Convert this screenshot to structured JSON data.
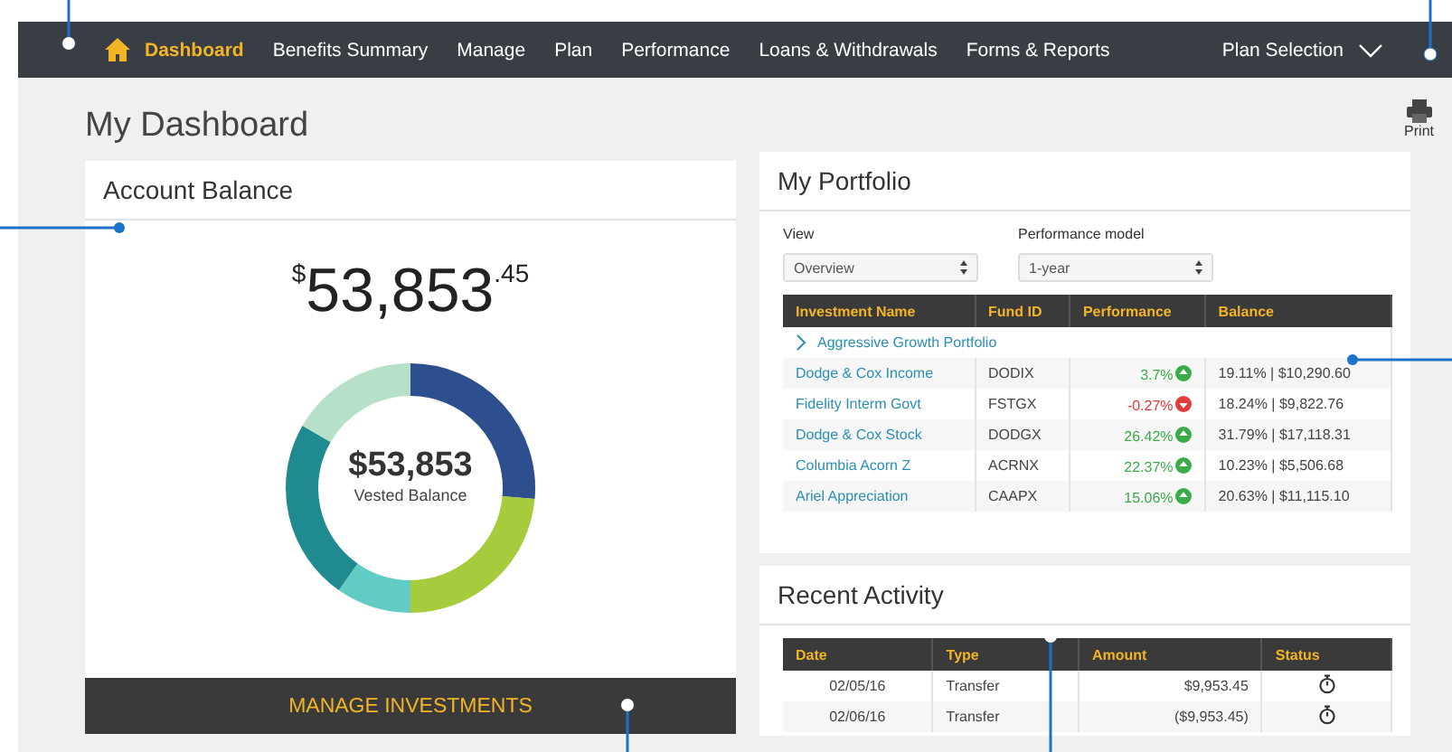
{
  "nav": {
    "items": [
      {
        "label": "Dashboard",
        "selected": true
      },
      {
        "label": "Benefits Summary",
        "selected": false
      },
      {
        "label": "Manage",
        "selected": false
      },
      {
        "label": "Plan",
        "selected": false
      },
      {
        "label": "Performance",
        "selected": false
      },
      {
        "label": "Loans & Withdrawals",
        "selected": false
      },
      {
        "label": "Forms & Reports",
        "selected": false
      }
    ],
    "plan_selection": "Plan Selection"
  },
  "page_title": "My Dashboard",
  "print": "Print",
  "account_balance": {
    "title": "Account Balance",
    "currency": "$",
    "whole": "53,853",
    "cents": ".45",
    "donut_value": "$53,853",
    "donut_label": "Vested Balance",
    "button": "MANAGE INVESTMENTS"
  },
  "portfolio": {
    "title": "My Portfolio",
    "view_label": "View",
    "view_value": "Overview",
    "model_label": "Performance model",
    "model_value": "1-year",
    "columns": [
      "Investment Name",
      "Fund ID",
      "Performance",
      "Balance"
    ],
    "group": "Aggressive Growth Portfolio",
    "rows": [
      {
        "name": "Dodge & Cox Income",
        "fund": "DODIX",
        "performance": "3.7%",
        "kind": "gain",
        "balance": "19.11%  |  $10,290.60"
      },
      {
        "name": "Fidelity Interm Govt",
        "fund": "FSTGX",
        "performance": "-0.27%",
        "kind": "loss",
        "balance": "18.24%  |  $9,822.76"
      },
      {
        "name": "Dodge & Cox Stock",
        "fund": "DODGX",
        "performance": "26.42%",
        "kind": "gain",
        "balance": "31.79%  |  $17,118.31"
      },
      {
        "name": "Columbia Acorn Z",
        "fund": "ACRNX",
        "performance": "22.37%",
        "kind": "gain",
        "balance": "10.23%  |  $5,506.68"
      },
      {
        "name": "Ariel Appreciation",
        "fund": "CAAPX",
        "performance": "15.06%",
        "kind": "gain",
        "balance": "20.63%  |  $11,115.10"
      }
    ]
  },
  "recent_activity": {
    "title": "Recent Activity",
    "columns": [
      "Date",
      "Type",
      "Amount",
      "Status"
    ],
    "rows": [
      {
        "date": "02/05/16",
        "type": "Transfer",
        "amount": "$9,953.45"
      },
      {
        "date": "02/06/16",
        "type": "Transfer",
        "amount": "($9,953.45)"
      }
    ]
  }
}
